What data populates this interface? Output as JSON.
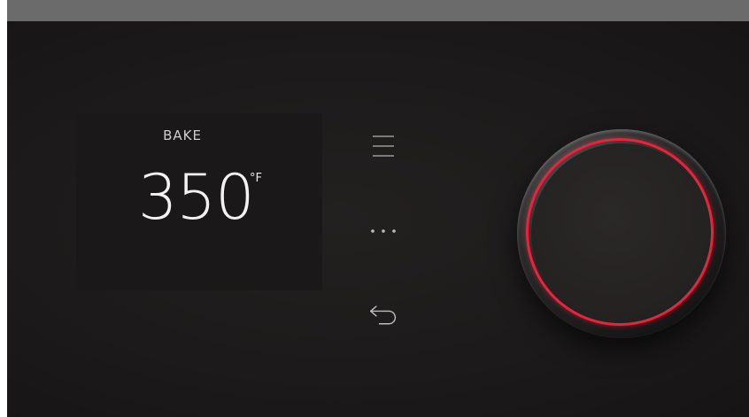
{
  "display": {
    "mode": "BAKE",
    "temperature": "350",
    "unit": "°F"
  },
  "icons": {
    "menu": "menu-icon",
    "more": "more-options-icon",
    "back": "back-arrow-icon"
  },
  "colors": {
    "panel": "#1c1a1a",
    "top_bar": "#6b6b6b",
    "accent_ring": "#e8243a",
    "text": "#f2f2f2"
  }
}
